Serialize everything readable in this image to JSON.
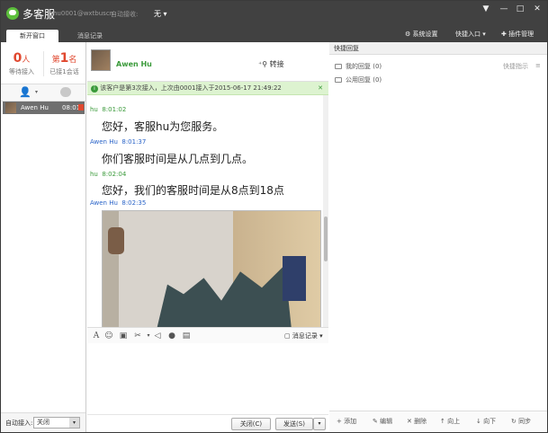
{
  "titlebar": {
    "app_title": "多客服",
    "account": "hu0001@wxtbuscn",
    "auto_receive_label": "自动接收:",
    "auto_receive_value": "无"
  },
  "tabs": [
    "新开窗口",
    "消息记录"
  ],
  "toolbar_right": {
    "settings": "系统设置",
    "quick_entry": "快捷入口",
    "plugins": "插件管理"
  },
  "left": {
    "waiting_count": "0",
    "waiting_unit": "人",
    "waiting_label": "等待接入",
    "rank_prefix": "第",
    "rank_value": "1",
    "rank_unit": "名",
    "connected_label": "已接1会话",
    "conversation": {
      "name": "Awen Hu",
      "time": "08:01"
    },
    "auto_label": "自动接入:",
    "auto_value": "关闭"
  },
  "chat": {
    "user": "Awen Hu",
    "transfer": "转接",
    "notice": "该客户是第3次接入，上次由0001接入于2015-06-17 21:49:22",
    "messages": [
      {
        "sender": "hu",
        "time": "8:01:02",
        "text": "您好，客服hu为您服务。"
      },
      {
        "sender": "Awen Hu",
        "time": "8:01:37",
        "text": "你们客服时间是从几点到几点。"
      },
      {
        "sender": "hu",
        "time": "8:02:04",
        "text": "您好，我们的客服时间是从8点到18点"
      },
      {
        "sender": "Awen Hu",
        "time": "8:02:35",
        "text": ""
      }
    ],
    "history_btn": "消息记录",
    "close_btn": "关闭(C)",
    "send_btn": "发送(S)"
  },
  "quick": {
    "header": "快捷回复",
    "my_replies": "我的回复 (0)",
    "public_replies": "公用回复 (0)",
    "collapse": "快捷指示",
    "actions": [
      "添加",
      "编辑",
      "删除",
      "向上",
      "向下",
      "同步"
    ]
  },
  "colors": {
    "titlebar": "#414141",
    "agent": "#3a9a3a",
    "customer": "#2a64c8",
    "notice_bg": "#ddf3d0",
    "badge": "#e0482f"
  }
}
